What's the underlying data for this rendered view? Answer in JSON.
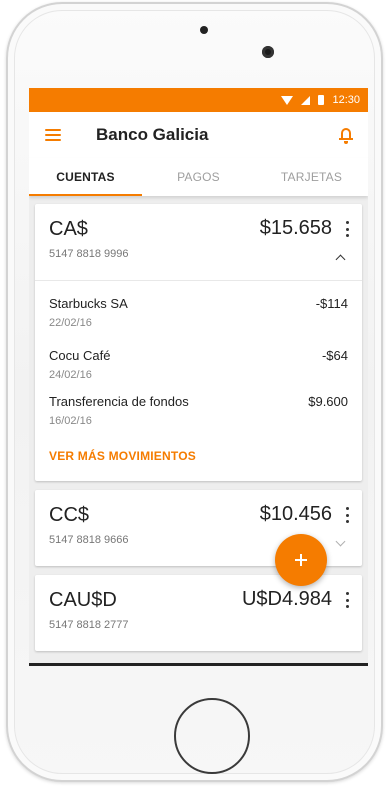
{
  "status_bar": {
    "time": "12:30"
  },
  "app_bar": {
    "title": "Banco Galicia",
    "menu_icon": "hamburger-menu-icon",
    "notification_icon": "bell-icon"
  },
  "tabs": [
    {
      "label": "CUENTAS",
      "active": true
    },
    {
      "label": "PAGOS",
      "active": false
    },
    {
      "label": "TARJETAS",
      "active": false
    }
  ],
  "accounts": [
    {
      "name": "CA$",
      "number": "5147 8818 9996",
      "balance": "$15.658",
      "expanded": true,
      "movements": [
        {
          "description": "Starbucks SA",
          "date": "22/02/16",
          "amount": "-$114"
        },
        {
          "description": "Cocu Café",
          "date": "24/02/16",
          "amount": "-$64"
        },
        {
          "description": "Transferencia de fondos",
          "date": "16/02/16",
          "amount": "$9.600"
        }
      ],
      "see_more_label": "VER MÁS MOVIMIENTOS"
    },
    {
      "name": "CC$",
      "number": "5147 8818 9666",
      "balance": "$10.456",
      "expanded": false
    },
    {
      "name": "CAU$D",
      "number": "5147 8818 2777",
      "balance": "U$D4.984",
      "expanded": false
    }
  ],
  "fab": {
    "icon": "plus-icon"
  },
  "colors": {
    "accent": "#f57c00",
    "background": "#eeeeee"
  }
}
